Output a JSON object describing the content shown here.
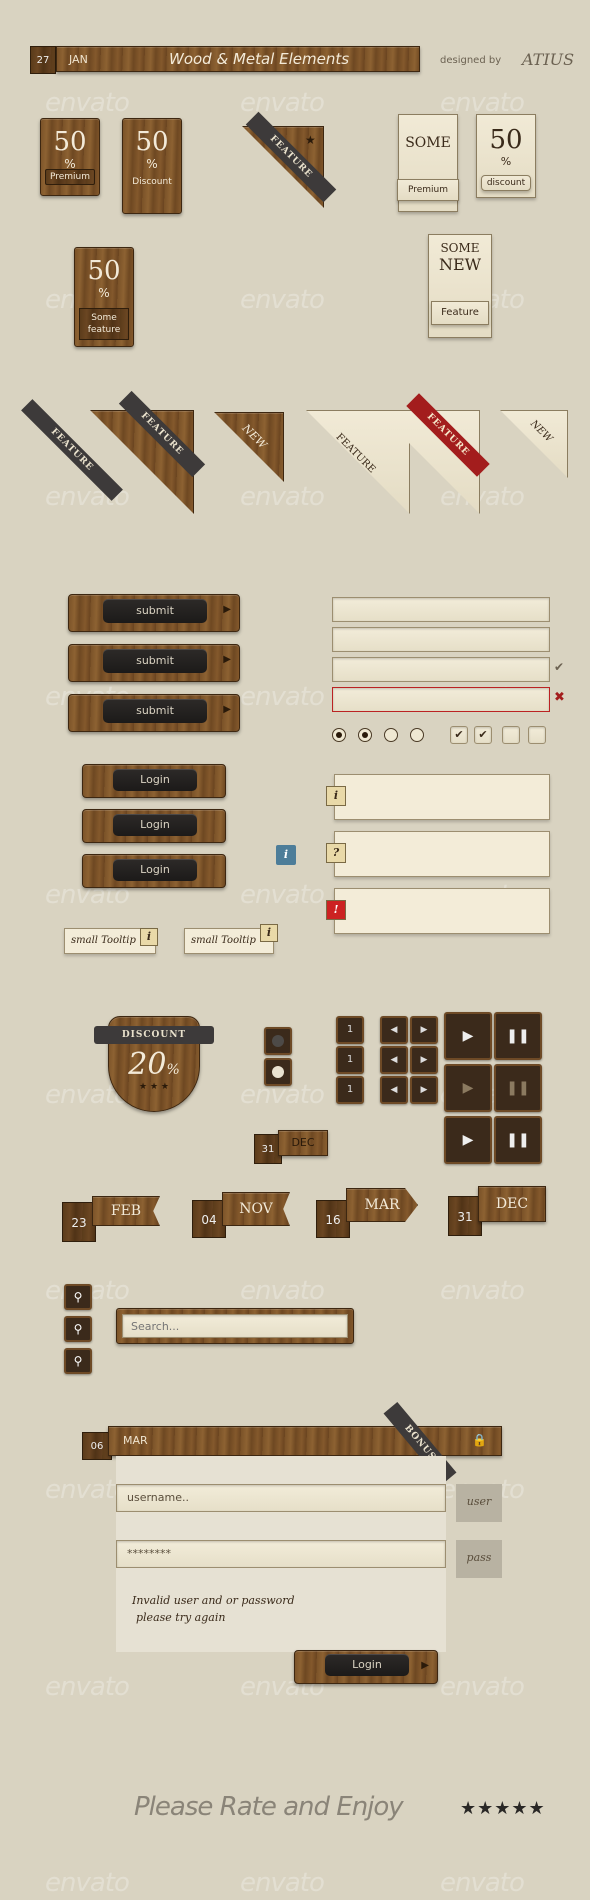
{
  "header": {
    "day": "27",
    "month": "JAN",
    "title": "Wood & Metal Elements",
    "designed_by": "designed by",
    "author": "ATIUS"
  },
  "watermark": "envato",
  "price_badges": [
    {
      "value": "50",
      "symbol": "%",
      "label": "Premium"
    },
    {
      "value": "50",
      "symbol": "%",
      "label": "Discount"
    },
    {
      "value": "50",
      "symbol": "%",
      "label": "Some feature"
    }
  ],
  "paper_badges": [
    {
      "value": "SOME",
      "label": "Premium"
    },
    {
      "value": "50",
      "symbol": "%",
      "label": "discount"
    },
    {
      "value_line1": "SOME",
      "value_line2": "NEW",
      "label": "Feature"
    }
  ],
  "ribbons": {
    "feature": "FEATURE",
    "new": "NEW",
    "star": "★"
  },
  "buttons": {
    "submit": "submit",
    "login": "Login"
  },
  "tooltips": {
    "small": "small Tooltip",
    "info_icon": "i",
    "question_icon": "?",
    "alert_icon": "!"
  },
  "discount": {
    "label": "DISCOUNT",
    "value": "20",
    "symbol": "%",
    "stars": "★ ★ ★"
  },
  "dates": [
    {
      "day": "31",
      "month": "DEC"
    },
    {
      "day": "23",
      "month": "FEB"
    },
    {
      "day": "04",
      "month": "NOV"
    },
    {
      "day": "16",
      "month": "MAR"
    },
    {
      "day": "31",
      "month": "DEC"
    }
  ],
  "pager": [
    "1",
    "1",
    "1"
  ],
  "search": {
    "placeholder": "Search..."
  },
  "login_form": {
    "day": "06",
    "month": "MAR",
    "bonus": "BONUS",
    "username_placeholder": "username..",
    "password_value": "********",
    "user_tab": "user",
    "pass_tab": "pass",
    "error_line1": "Invalid user and or password",
    "error_line2": "please try again",
    "submit": "Login"
  },
  "footer": {
    "text": "Please Rate and Enjoy",
    "stars": "★★★★★"
  },
  "colors": {
    "wood": "#7a5228",
    "paper": "#efe8d2",
    "dark": "#2a2826",
    "red": "#a31d1d",
    "background": "#d9d3c1"
  }
}
